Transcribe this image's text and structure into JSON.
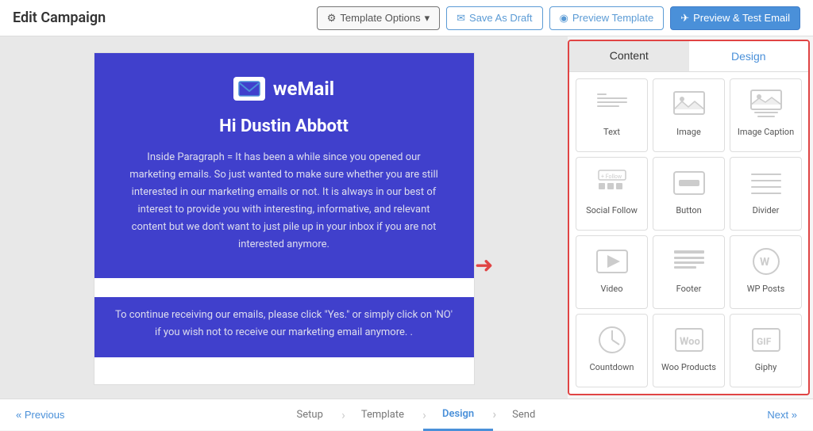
{
  "header": {
    "title": "Edit Campaign",
    "buttons": {
      "template_options": "Template Options",
      "save_as_draft": "Save As Draft",
      "preview_template": "Preview Template",
      "preview_test": "Preview & Test Email"
    }
  },
  "email": {
    "brand_name": "weMail",
    "greeting": "Hi Dustin Abbott",
    "paragraph": "Inside Paragraph = It has been a while since you opened our marketing emails. So just wanted to make sure whether you are still interested in our marketing emails or not. It is always in our best of interest to provide you with interesting, informative, and relevant content but we don't want to just pile up in your inbox if you are not interested anymore.",
    "cta_text": "To continue receiving our emails, please click \"Yes.\" or simply click on 'NO' if you wish not to receive our marketing email anymore. ."
  },
  "right_panel": {
    "tabs": [
      "Content",
      "Design"
    ],
    "active_tab": "Content",
    "items": [
      {
        "label": "Text",
        "icon": "text-icon"
      },
      {
        "label": "Image",
        "icon": "image-icon"
      },
      {
        "label": "Image Caption",
        "icon": "image-caption-icon"
      },
      {
        "label": "Social Follow",
        "icon": "social-follow-icon"
      },
      {
        "label": "Button",
        "icon": "button-icon"
      },
      {
        "label": "Divider",
        "icon": "divider-icon"
      },
      {
        "label": "Video",
        "icon": "video-icon"
      },
      {
        "label": "Footer",
        "icon": "footer-icon"
      },
      {
        "label": "WP Posts",
        "icon": "wp-posts-icon"
      },
      {
        "label": "Countdown",
        "icon": "countdown-icon"
      },
      {
        "label": "Woo Products",
        "icon": "woo-products-icon"
      },
      {
        "label": "Giphy",
        "icon": "giphy-icon"
      }
    ]
  },
  "footer_nav": {
    "prev_label": "« Previous",
    "next_label": "Next »",
    "steps": [
      "Setup",
      "Template",
      "Design",
      "Send"
    ],
    "active_step": "Design"
  }
}
